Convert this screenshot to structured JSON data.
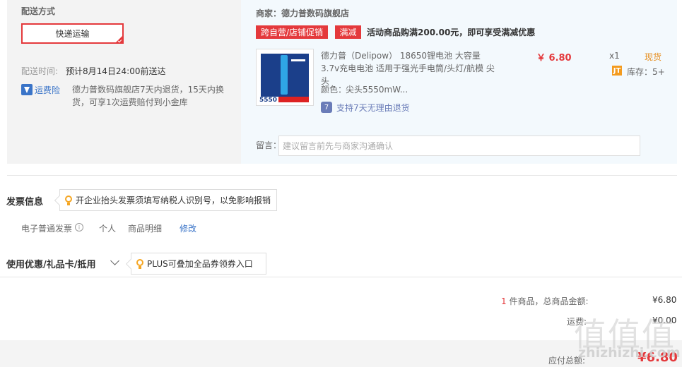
{
  "shipping": {
    "title": "配送方式",
    "method": "快递运输",
    "time_label": "配送时间:",
    "time_value": "预计8月14日24:00前送达",
    "freight_icon": "shield-icon",
    "freight_label": "运费险",
    "freight_desc": "德力普数码旗舰店7天内退货，15天内换货，可享1次运费赔付到小金库"
  },
  "seller": {
    "line": "商家：德力普数码旗舰店",
    "tags": [
      "跨自营/店铺促销",
      "满减"
    ],
    "promo": "活动商品购满200.00元，即可享受满减优惠"
  },
  "product": {
    "image_label": "5550",
    "name": "德力普（Delipow） 18650锂电池 大容量3.7v充电电池 适用于强光手电筒/头灯/航模 尖头",
    "price": "￥ 6.80",
    "qty": "x1",
    "stock_status": "现货",
    "stock_icon_label": "JT",
    "stock_text": "库存：5+",
    "color_label": "颜色：",
    "color_value": "尖头5550mW...",
    "return_icon_label": "7",
    "return_text": "支持7天无理由退货",
    "message_label": "留言：",
    "message_placeholder": "建议留言前先与商家沟通确认"
  },
  "invoice": {
    "title": "发票信息",
    "tip": "开企业抬头发票须填写纳税人识别号，以免影响报销",
    "type": "电子普通发票",
    "info_icon_label": "i",
    "party": "个人",
    "content": "商品明细",
    "edit": "修改"
  },
  "coupon": {
    "title": "使用优惠/礼品卡/抵用",
    "tip": "PLUS可叠加全品券领券入口"
  },
  "summary": {
    "count": "1",
    "count_suffix": " 件商品，总商品金额:",
    "goods_total": "¥6.80",
    "freight_label": "运费:",
    "freight_value": "¥0.00",
    "payable_label": "应付总额:",
    "payable_value": "¥6.80"
  },
  "watermark": {
    "glyphs": "值值值",
    "text": "zhizhizhi.com"
  },
  "colors": {
    "accent_red": "#e4393c",
    "link_blue": "#3a74c8",
    "stock_orange": "#e68c1a"
  }
}
